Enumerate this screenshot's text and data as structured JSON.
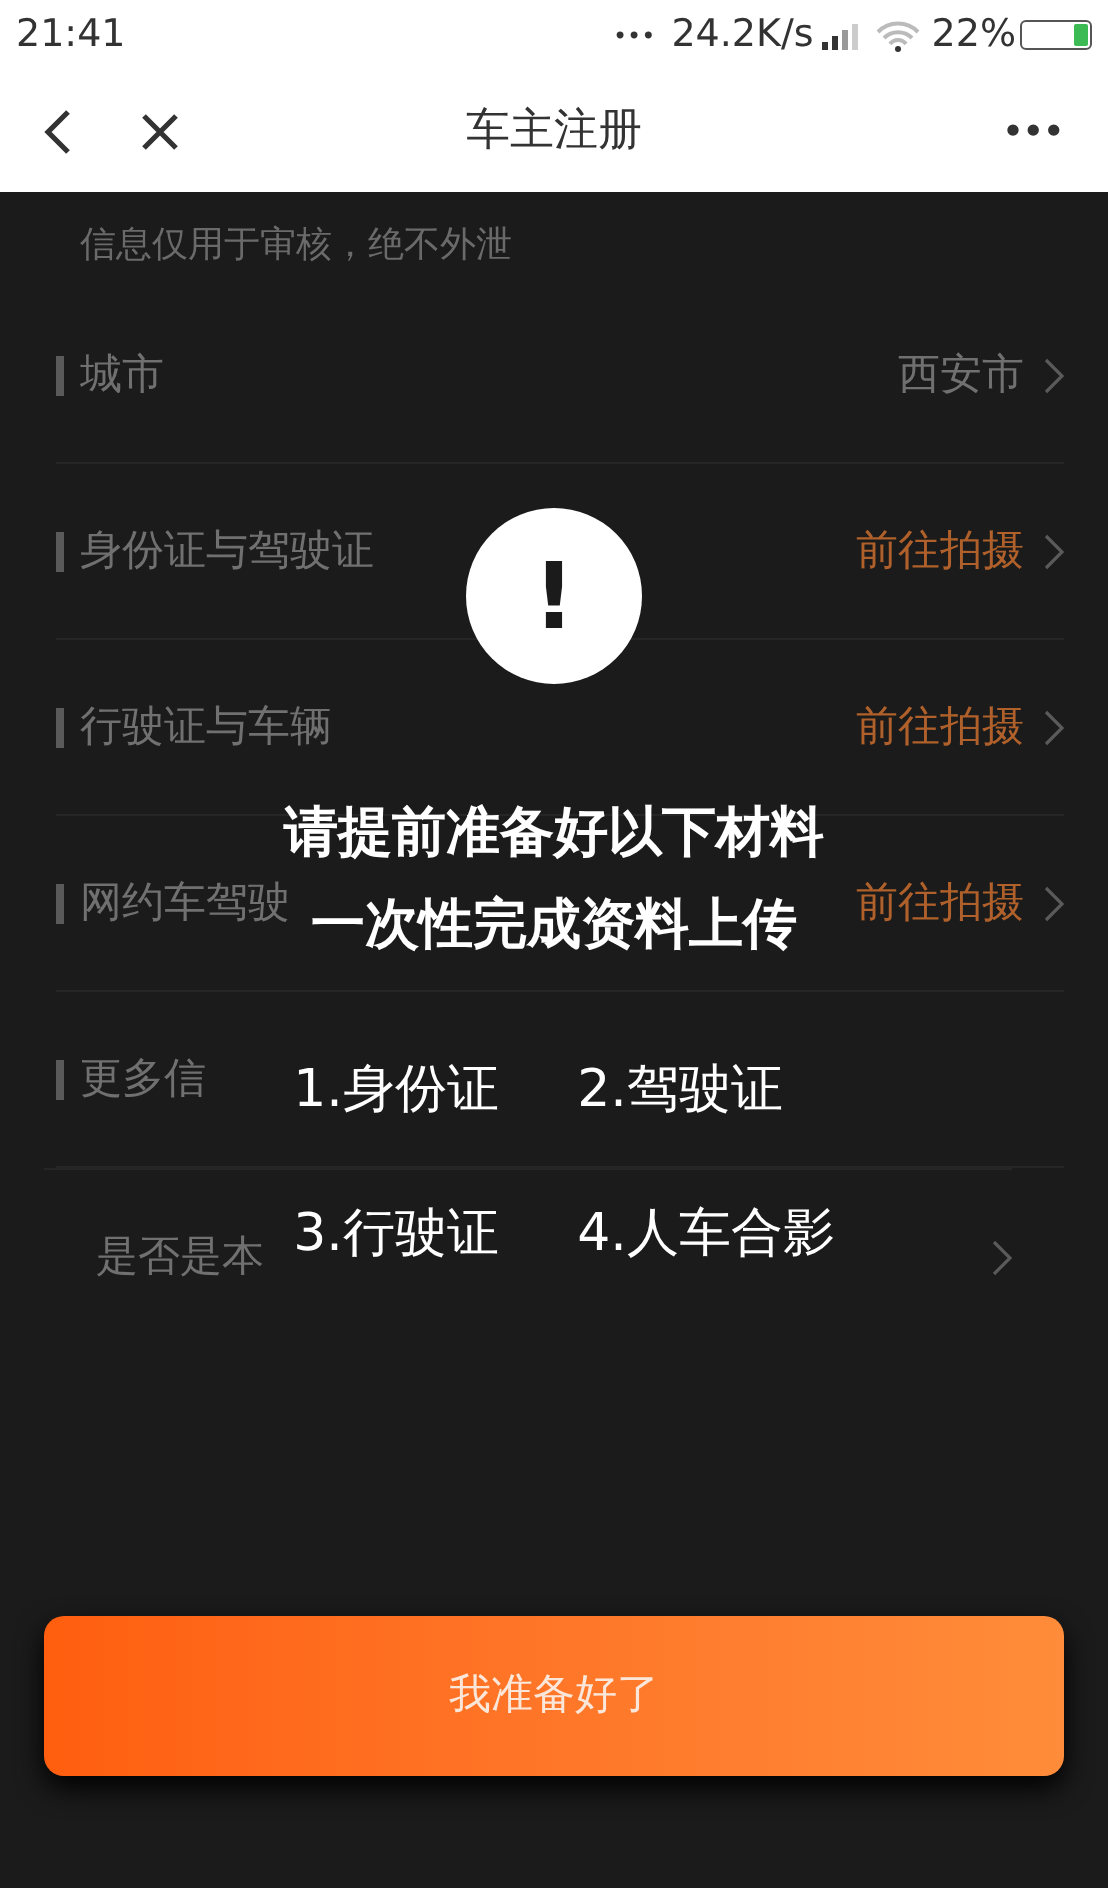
{
  "status_bar": {
    "time": "21:41",
    "dots": "•••",
    "network_speed": "24.2K/s",
    "battery": "22%"
  },
  "nav": {
    "title": "车主注册",
    "more": "•••"
  },
  "form": {
    "note": "信息仅用于审核，绝不外泄",
    "rows": [
      {
        "kind": "value",
        "label": "城市",
        "value": "西安市"
      },
      {
        "kind": "action",
        "label": "身份证与驾驶证",
        "value": "前往拍摄"
      },
      {
        "kind": "action",
        "label": "行驶证与车辆",
        "value": "前往拍摄"
      },
      {
        "kind": "action",
        "label": "网约车驾驶",
        "value": "前往拍摄"
      },
      {
        "kind": "section",
        "label": "更多信"
      },
      {
        "kind": "sub",
        "label": "是否是本"
      }
    ]
  },
  "dialog": {
    "icon": "!",
    "lines": [
      "请提前准备好以下材料",
      "一次性完成资料上传"
    ],
    "items": [
      [
        "1.身份证",
        "2.驾驶证"
      ],
      [
        "3.行驶证",
        "4.人车合影"
      ]
    ],
    "button": "我准备好了"
  }
}
